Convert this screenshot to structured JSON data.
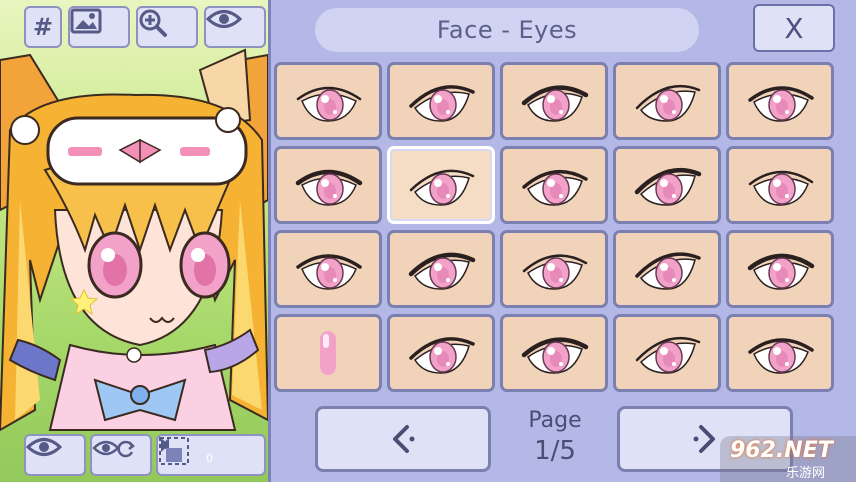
{
  "toolbar": {
    "hash_label": "#",
    "icons": [
      "image-icon",
      "zoom-in-icon",
      "eye-icon"
    ]
  },
  "panel": {
    "title": "Face - Eyes",
    "close_label": "X"
  },
  "pagination": {
    "page_label": "Page",
    "page_value": "1/5"
  },
  "eyes": {
    "count": 20,
    "selected_index": 6,
    "iris_color": "#f2a2c8",
    "skin_color": "#f0d3b9"
  },
  "bottom_controls": {
    "icons": [
      "eye-icon",
      "eye-refresh-icon",
      "chevron-left-icon",
      "layer-icon",
      "chevron-right-icon"
    ],
    "layer_value": "0"
  },
  "watermark": {
    "main": "962.NET",
    "sub": "乐游网"
  },
  "colors": {
    "panel_bg": "#b4b8e6",
    "button_bg": "#dfe2f7",
    "border": "#7c80b0",
    "text": "#4a4e75"
  }
}
